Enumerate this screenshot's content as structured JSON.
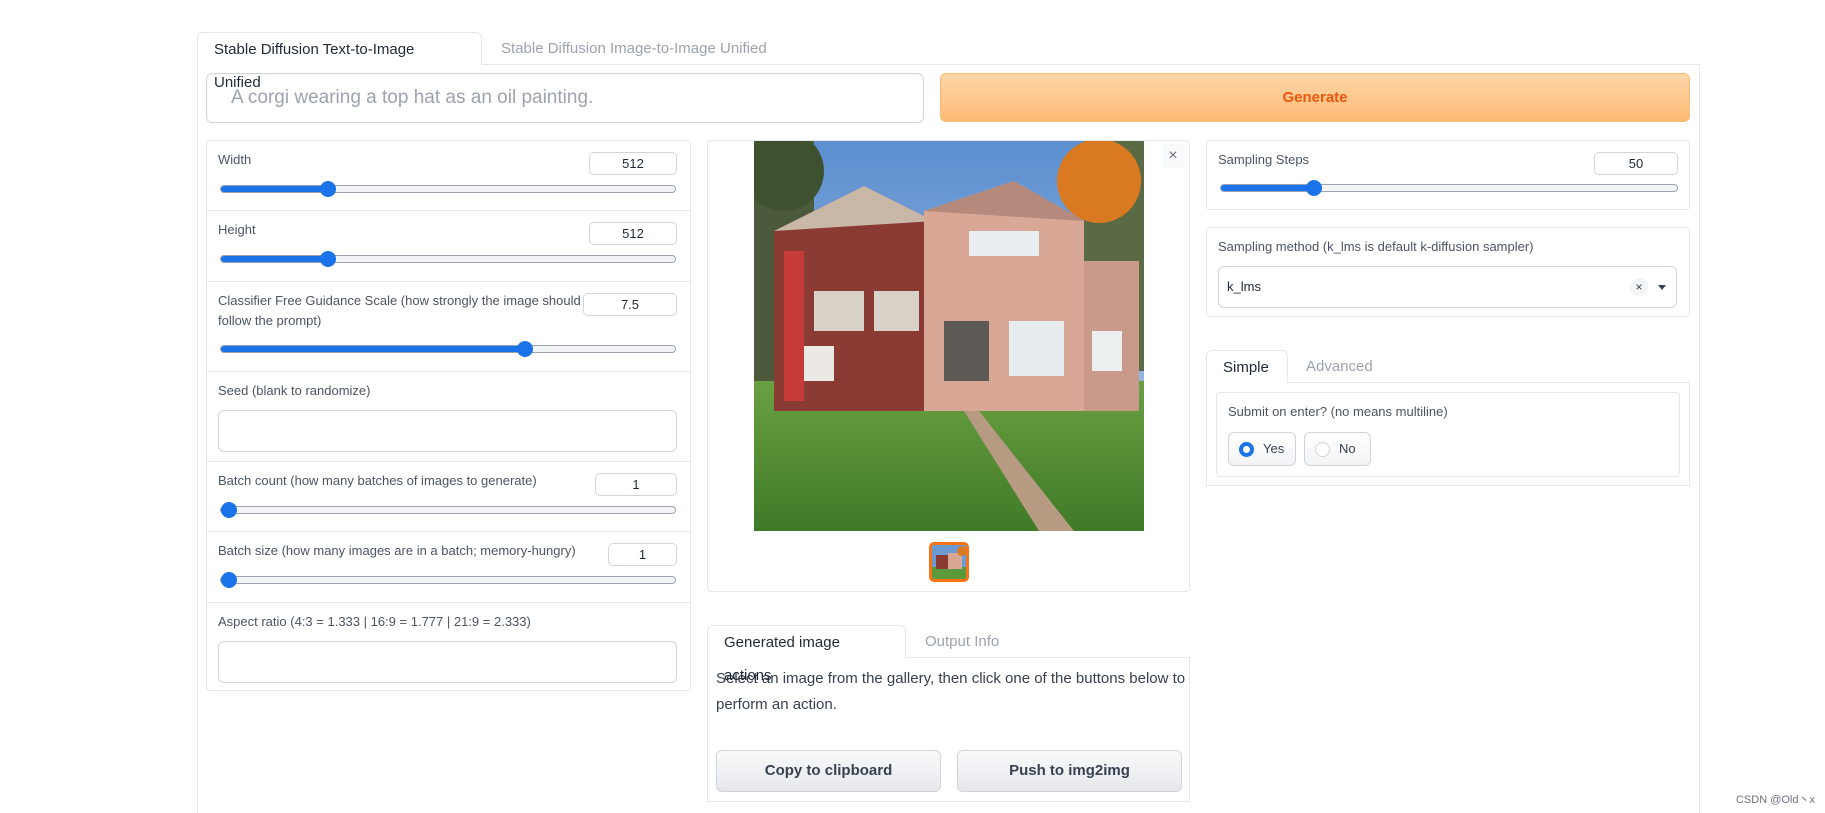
{
  "tabs": {
    "txt2img": "Stable Diffusion Text-to-Image Unified",
    "img2img": "Stable Diffusion Image-to-Image Unified"
  },
  "prompt": {
    "placeholder": "A corgi wearing a top hat as an oil painting."
  },
  "generate_label": "Generate",
  "left": {
    "width": {
      "label": "Width",
      "value": "512",
      "fraction": 0.235
    },
    "height": {
      "label": "Height",
      "value": "512",
      "fraction": 0.235
    },
    "cfg": {
      "label": "Classifier Free Guidance Scale (how strongly the image should follow the prompt)",
      "value": "7.5",
      "fraction": 0.67
    },
    "seed": {
      "label": "Seed (blank to randomize)"
    },
    "batch_count": {
      "label": "Batch count (how many batches of images to generate)",
      "value": "1",
      "fraction": 0.0
    },
    "batch_size": {
      "label": "Batch size (how many images are in a batch; memory-hungry)",
      "value": "1",
      "fraction": 0.0
    },
    "aspect": {
      "label": "Aspect ratio (4:3 = 1.333 | 16:9 = 1.777 | 21:9 = 2.333)"
    }
  },
  "gallery": {
    "close": "×"
  },
  "actions": {
    "tab_actions": "Generated image actions",
    "tab_output": "Output Info",
    "description": "Select an image from the gallery, then click one of the buttons below to perform an action.",
    "copy": "Copy to clipboard",
    "push": "Push to img2img"
  },
  "right": {
    "steps": {
      "label": "Sampling Steps",
      "value": "50",
      "fraction": 0.205
    },
    "sampler": {
      "label": "Sampling method (k_lms is default k-diffusion sampler)",
      "value": "k_lms",
      "clear": "×"
    },
    "tab_simple": "Simple",
    "tab_advanced": "Advanced",
    "submit": {
      "label": "Submit on enter? (no means multiline)",
      "yes": "Yes",
      "no": "No",
      "selected": "Yes"
    }
  },
  "watermark": "CSDN @Old丶x",
  "colors": {
    "accent": "#1a73e8",
    "generate_text": "#ea580c",
    "generate_bg": "#fdba74",
    "selected_thumb_border": "#f97316"
  }
}
